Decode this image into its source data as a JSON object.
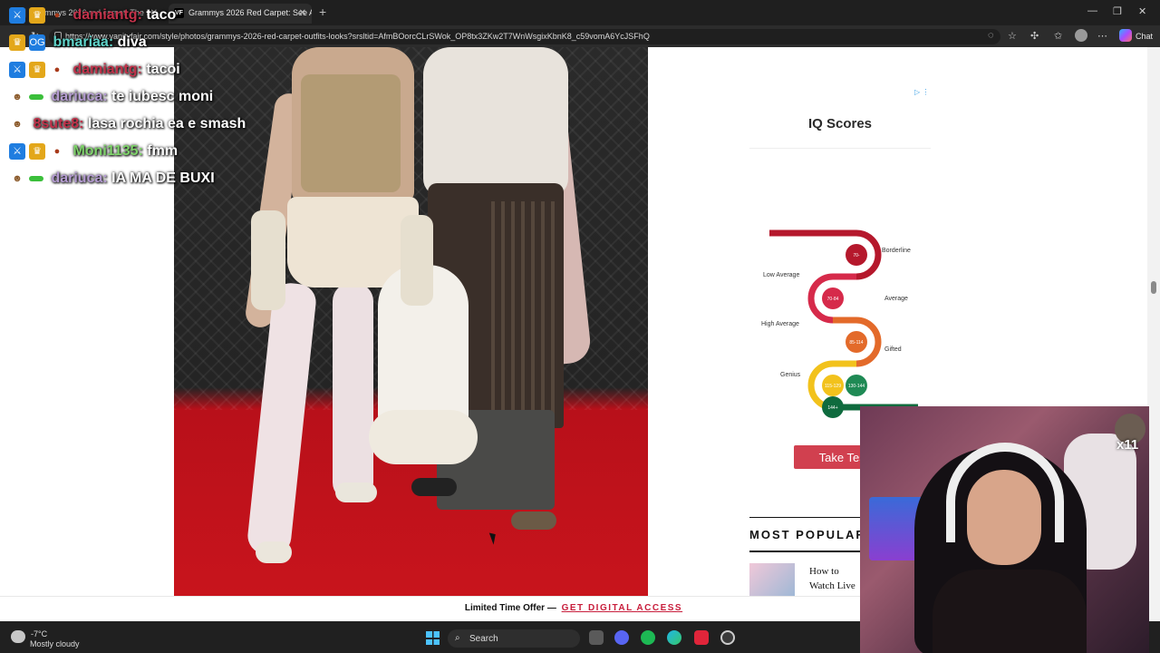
{
  "browser": {
    "tabs": [
      {
        "title": "Grammys 2026 red carpet: The be"
      },
      {
        "title": "Grammys 2026 Red Carpet: See Al"
      }
    ],
    "url": "https://www.vanityfair.com/style/photos/grammys-2026-red-carpet-outfits-looks?srsltid=AfmBOorcCLrSWok_OP8tx3ZKw2T7WnWsgixKbnK8_c59vomA6YcJSFhQ",
    "chat_label": "Chat"
  },
  "chat": [
    {
      "user": "damiantg:",
      "message": "taco",
      "color": "#c2324a"
    },
    {
      "user": "bmariaa:",
      "message": "diva",
      "color": "#5fd3c9"
    },
    {
      "user": "damiantg:",
      "message": "tacoi",
      "color": "#c2324a"
    },
    {
      "user": "dariuca:",
      "message": "te iubesc moni",
      "color": "#b49bd1"
    },
    {
      "user": "8sute8:",
      "message": "lasa rochia ea e smash",
      "color": "#c2324a"
    },
    {
      "user": "Moni1135:",
      "message": "fmm",
      "color": "#7fd36b"
    },
    {
      "user": "dariuca:",
      "message": "IA MA DE BUXI",
      "color": "#b49bd1"
    }
  ],
  "ad": {
    "title": "IQ Scores",
    "levels": [
      {
        "name": "Borderline",
        "range": "70-",
        "color": "#b5182c"
      },
      {
        "name": "Low Average",
        "range": "70-84",
        "color": "#d62a4a"
      },
      {
        "name": "Average",
        "range": "85-114",
        "color": "#e36a2a"
      },
      {
        "name": "High Average",
        "range": "115-129",
        "color": "#f2c21c"
      },
      {
        "name": "Gifted",
        "range": "130-144",
        "color": "#1f8a55"
      },
      {
        "name": "Genius",
        "range": "144+",
        "color": "#0f6b3e"
      }
    ],
    "cta": "Take Test"
  },
  "sidebar": {
    "heading": "MOST POPULAR",
    "article": "How to Watch Live"
  },
  "promo": {
    "text": "Limited Time Offer —",
    "link": "GET DIGITAL ACCESS"
  },
  "webcam": {
    "badge": "x11"
  },
  "taskbar": {
    "temperature": "-7°C",
    "condition": "Mostly cloudy",
    "search_label": "Search"
  }
}
